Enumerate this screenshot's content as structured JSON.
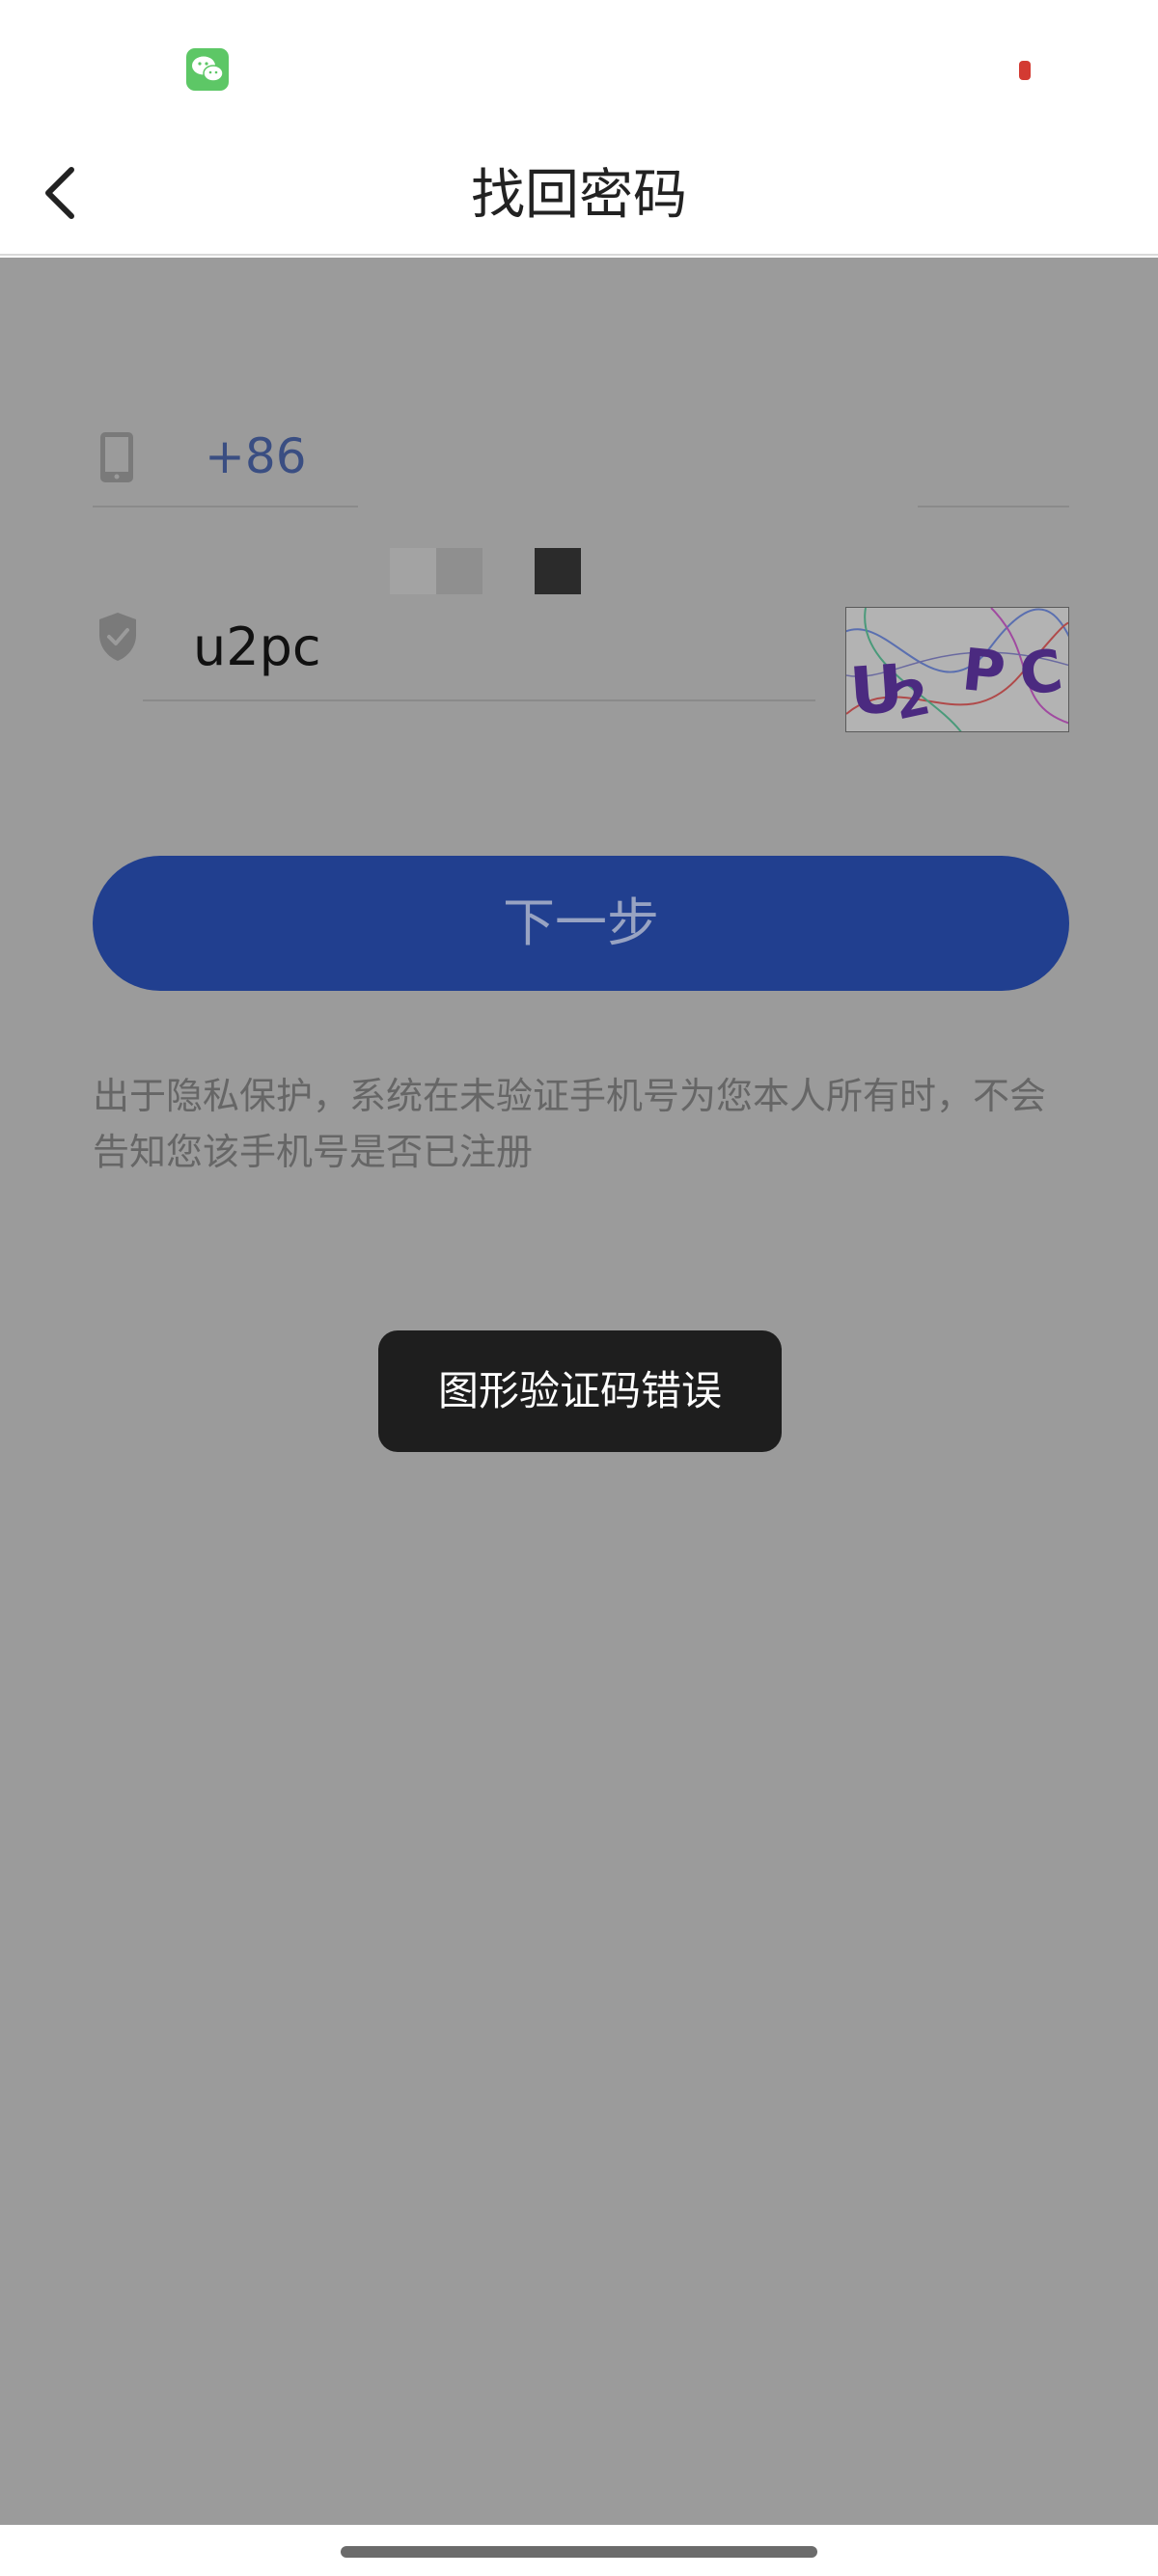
{
  "status_bar": {
    "wechat_icon": "wechat-icon",
    "battery_color": "#d33a32"
  },
  "nav": {
    "back_icon": "chevron-left-icon",
    "title": "找回密码"
  },
  "form": {
    "phone": {
      "icon": "phone-icon",
      "country_code": "+86"
    },
    "captcha": {
      "icon": "shield-check-icon",
      "value": "u2pc",
      "image_text": "U2PC"
    },
    "next_label": "下一步"
  },
  "privacy_notice": "出于隐私保护，系统在未验证手机号为您本人所有时，不会告知您该手机号是否已注册",
  "toast": "图形验证码错误",
  "colors": {
    "primary_button": "#213f8f",
    "overlay": "#9b9b9b",
    "toast_bg": "#1e1e1e"
  }
}
